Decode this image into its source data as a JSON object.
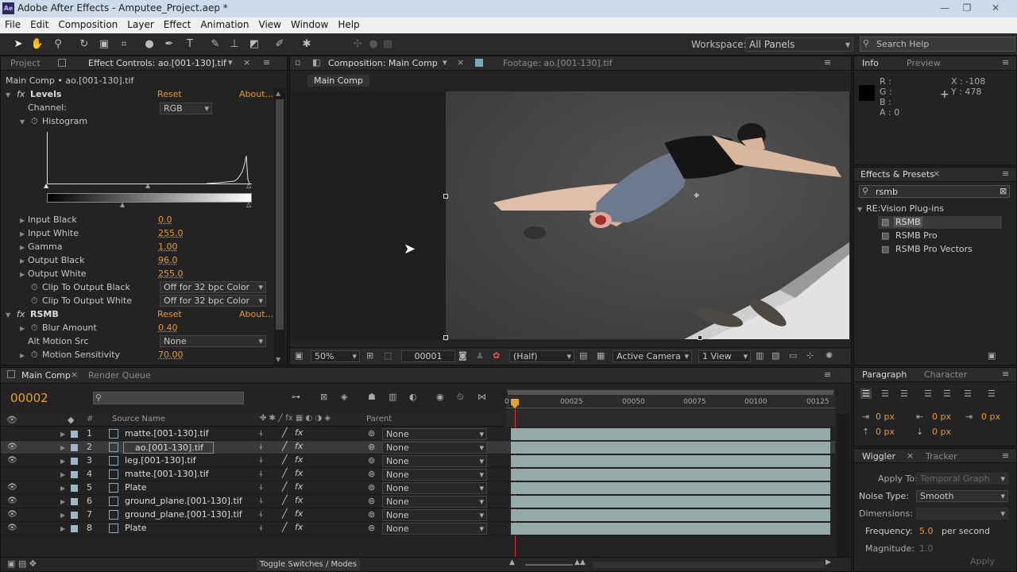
{
  "app": {
    "title": "Adobe After Effects - Amputee_Project.aep *",
    "icon_label": "Ae"
  },
  "menu": [
    "File",
    "Edit",
    "Composition",
    "Layer",
    "Effect",
    "Animation",
    "View",
    "Window",
    "Help"
  ],
  "toolbar": {
    "workspace_label": "Workspace:",
    "workspace_value": "All Panels",
    "search_placeholder": "Search Help"
  },
  "left_panel": {
    "tabs": [
      "Project",
      "Effect Controls: ao.[001-130].tif"
    ],
    "subject": "Main Comp • ao.[001-130].tif",
    "levels": {
      "name": "Levels",
      "reset": "Reset",
      "about": "About...",
      "channel_label": "Channel:",
      "channel_value": "RGB",
      "histogram": "Histogram",
      "props": [
        {
          "label": "Input Black",
          "value": "0.0"
        },
        {
          "label": "Input White",
          "value": "255.0"
        },
        {
          "label": "Gamma",
          "value": "1.00"
        },
        {
          "label": "Output Black",
          "value": "96.0"
        },
        {
          "label": "Output White",
          "value": "255.0"
        }
      ],
      "clip_black": {
        "label": "Clip To Output Black",
        "value": "Off for 32 bpc Color"
      },
      "clip_white": {
        "label": "Clip To Output White",
        "value": "Off for 32 bpc Color"
      }
    },
    "rsmb": {
      "name": "RSMB",
      "reset": "Reset",
      "about": "About...",
      "blur_label": "Blur Amount",
      "blur_value": "0.40",
      "alt_label": "Alt Motion Src",
      "alt_value": "None",
      "sens_label": "Motion Sensitivity",
      "sens_value": "70.00"
    }
  },
  "comp_panel": {
    "tabs": [
      "Composition: Main Comp",
      "Footage: ao.[001-130].tif"
    ],
    "breadcrumb": "Main Comp",
    "zoom": "50%",
    "frame": "00001",
    "resolution": "(Half)",
    "camera": "Active Camera",
    "views": "1 View"
  },
  "info_panel": {
    "tabs": [
      "Info",
      "Preview"
    ],
    "r": "R :",
    "g": "G :",
    "b": "B :",
    "a": "A : 0",
    "x": "X : -108",
    "y": "Y : 478"
  },
  "effects_panel": {
    "title": "Effects & Presets",
    "search": "rsmb",
    "group": "RE:Vision Plug-ins",
    "items": [
      "RSMB",
      "RSMB Pro",
      "RSMB Pro Vectors"
    ]
  },
  "timeline": {
    "tabs": [
      "Main Comp",
      "Render Queue"
    ],
    "current_time": "00002",
    "col_num": "#",
    "col_source": "Source Name",
    "col_parent": "Parent",
    "ruler": [
      "00025",
      "00050",
      "00075",
      "00100",
      "00125"
    ],
    "ruler_start": "0",
    "layers": [
      {
        "num": "1",
        "name": "matte.[001-130].tif",
        "parent": "None",
        "visible": false
      },
      {
        "num": "2",
        "name": "ao.[001-130].tif",
        "parent": "None",
        "visible": true
      },
      {
        "num": "3",
        "name": "leg.[001-130].tif",
        "parent": "None",
        "visible": true
      },
      {
        "num": "4",
        "name": "matte.[001-130].tif",
        "parent": "None",
        "visible": false
      },
      {
        "num": "5",
        "name": "Plate",
        "parent": "None",
        "visible": true
      },
      {
        "num": "6",
        "name": "ground_plane.[001-130].tif",
        "parent": "None",
        "visible": true
      },
      {
        "num": "7",
        "name": "ground_plane.[001-130].tif",
        "parent": "None",
        "visible": true
      },
      {
        "num": "8",
        "name": "Plate",
        "parent": "None",
        "visible": true
      }
    ],
    "toggle": "Toggle Switches / Modes"
  },
  "paragraph_panel": {
    "tabs": [
      "Paragraph",
      "Character"
    ],
    "px": [
      "0 px",
      "0 px",
      "0 px",
      "0 px",
      "0 px"
    ]
  },
  "wiggler_panel": {
    "tabs": [
      "Wiggler",
      "Tracker"
    ],
    "apply_label": "Apply To:",
    "apply_value": "Temporal Graph",
    "noise_label": "Noise Type:",
    "noise_value": "Smooth",
    "dim_label": "Dimensions:",
    "freq_label": "Frequency:",
    "freq_value": "5.0",
    "freq_unit": "per second",
    "mag_label": "Magnitude:",
    "mag_value": "1.0",
    "apply_button": "Apply"
  }
}
